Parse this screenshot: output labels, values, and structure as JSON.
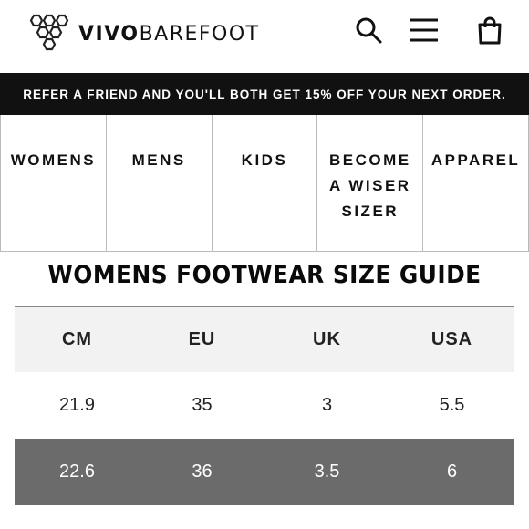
{
  "header": {
    "brand_bold": "VIVO",
    "brand_light": "BAREFOOT",
    "icons": [
      "hexagon-logo-icon",
      "search-icon",
      "hamburger-menu-icon",
      "shopping-bag-icon"
    ]
  },
  "promo": {
    "text": "REFER A FRIEND AND YOU'LL BOTH GET 15% OFF YOUR NEXT ORDER."
  },
  "nav": {
    "items": [
      {
        "line1": "WOMENS",
        "line2": "",
        "line3": ""
      },
      {
        "line1": "MENS",
        "line2": "",
        "line3": ""
      },
      {
        "line1": "KIDS",
        "line2": "",
        "line3": ""
      },
      {
        "line1": "BECOME",
        "line2": "A WISER",
        "line3": "SIZER"
      },
      {
        "line1": "APPAREL",
        "line2": "",
        "line3": ""
      }
    ]
  },
  "guide": {
    "title": "WOMENS FOOTWEAR SIZE GUIDE",
    "columns": [
      "CM",
      "EU",
      "UK",
      "USA"
    ],
    "rows": [
      [
        "21.9",
        "35",
        "3",
        "5.5"
      ],
      [
        "22.6",
        "36",
        "3.5",
        "6"
      ]
    ]
  },
  "colors": {
    "promo_bg": "#111111",
    "header_row_bg": "#f2f2f2",
    "highlight_row_bg": "#6b6b6b"
  }
}
